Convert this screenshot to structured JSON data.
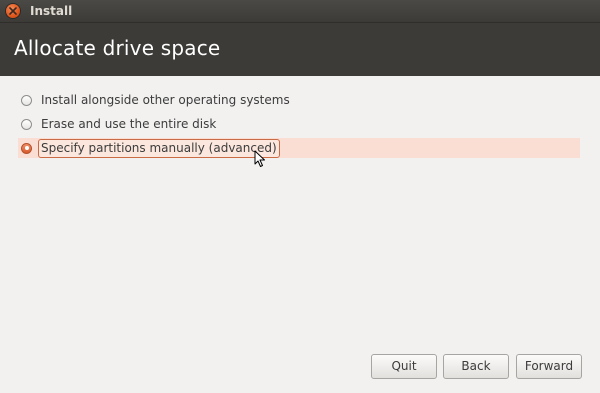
{
  "window": {
    "title": "Install"
  },
  "header": {
    "title": "Allocate drive space"
  },
  "options": [
    {
      "label": "Install alongside other operating systems",
      "selected": false
    },
    {
      "label": "Erase and use the entire disk",
      "selected": false
    },
    {
      "label": "Specify partitions manually (advanced)",
      "selected": true
    }
  ],
  "buttons": {
    "quit": "Quit",
    "back": "Back",
    "forward": "Forward"
  },
  "colors": {
    "titlebar": "#3c3b37",
    "accent": "#dd4814",
    "selected_row": "#fbded3"
  },
  "icons": {
    "close": "close-icon",
    "cursor": "mouse-pointer-icon"
  }
}
